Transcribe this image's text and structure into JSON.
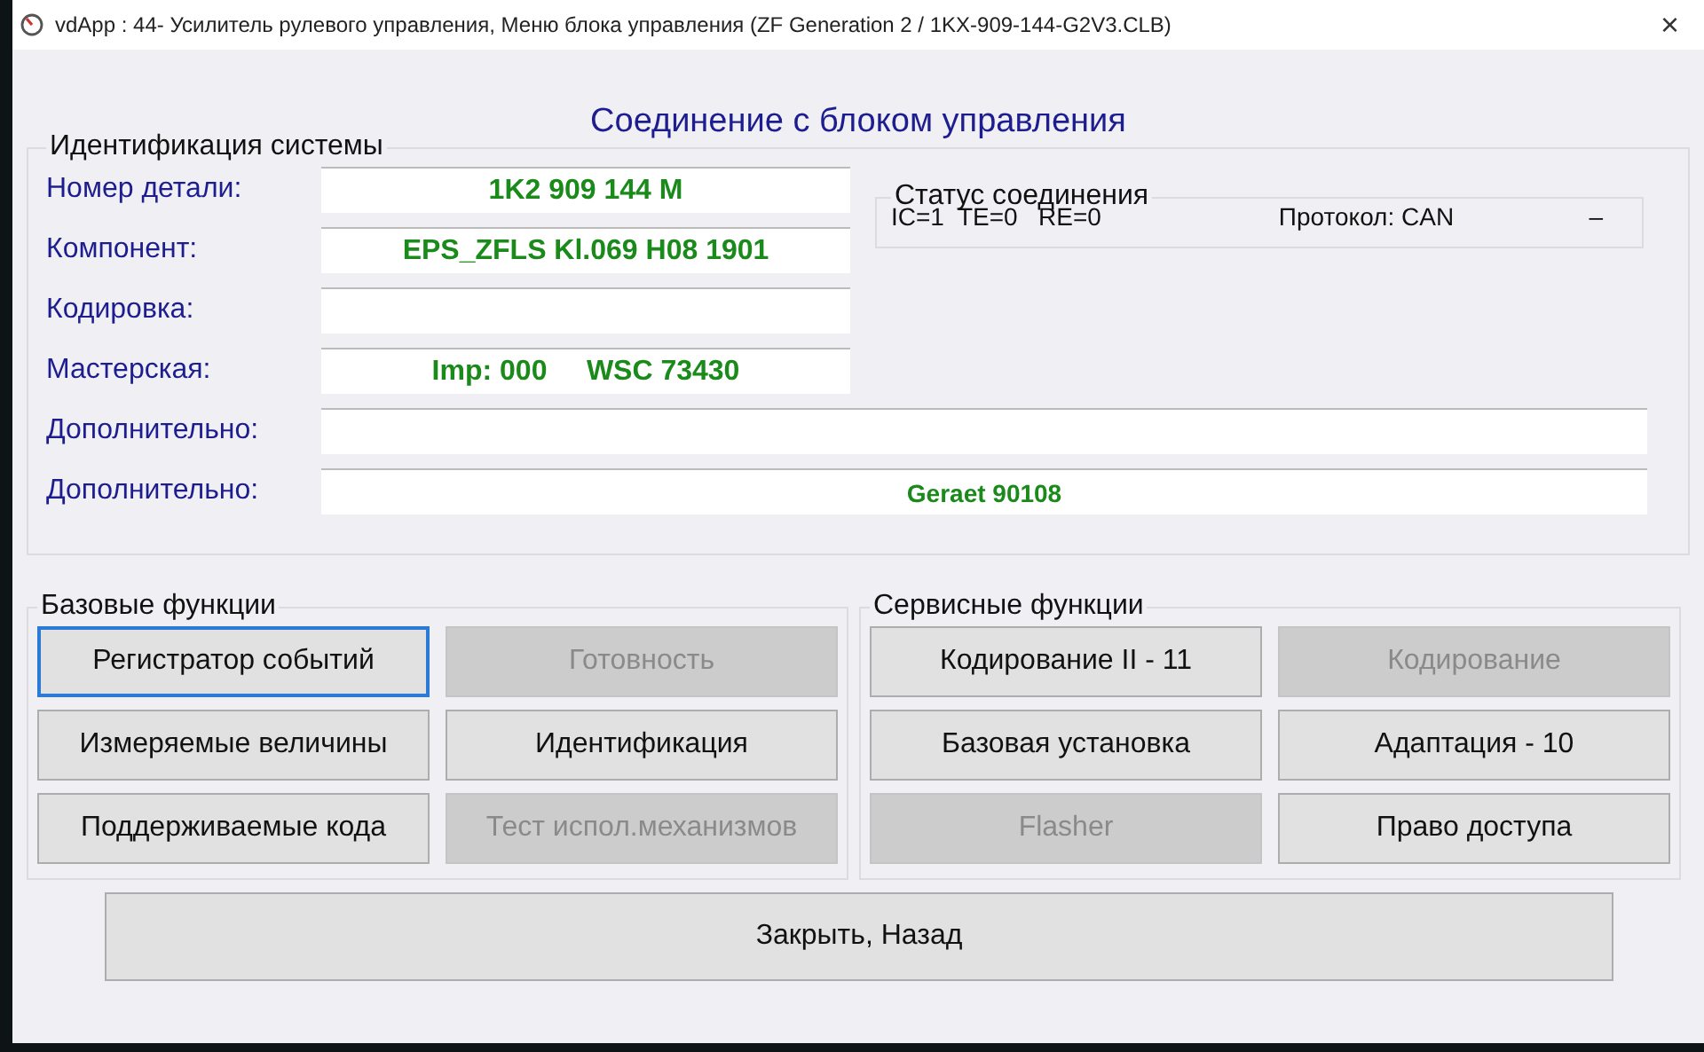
{
  "window": {
    "title": "vdApp : 44- Усилитель рулевого управления,  Меню блока управления (ZF Generation 2 / 1KX-909-144-G2V3.CLB)",
    "close": "×"
  },
  "heading": "Соединение с блоком управления",
  "identification": {
    "title": "Идентификация системы",
    "fields": [
      {
        "label": "Номер детали:",
        "value": "1K2 909 144 M"
      },
      {
        "label": "Компонент:",
        "value": "EPS_ZFLS Kl.069 H08 1901"
      },
      {
        "label": "Кодировка:"
      },
      {
        "label": "Мастерская:",
        "value": "Imp: 000     WSC 73430"
      }
    ],
    "extra_fields": [
      {
        "label": "Дополнительно:"
      },
      {
        "label": "Дополнительно:",
        "value": "Geraet 90108"
      }
    ]
  },
  "status": {
    "title": "Статус соединения",
    "counters": "IC=1  TE=0   RE=0",
    "protocol": "Протокол: CAN",
    "indicator": "–"
  },
  "basic": {
    "title": "Базовые функции",
    "buttons": [
      {
        "label": "Регистратор событий",
        "disabled": false,
        "focused": true
      },
      {
        "label": "Готовность",
        "disabled": true,
        "focused": false
      },
      {
        "label": "Измеряемые величины",
        "disabled": false,
        "focused": false
      },
      {
        "label": "Идентификация",
        "disabled": false,
        "focused": false
      },
      {
        "label": "Поддерживаемые кода",
        "disabled": false,
        "focused": false
      },
      {
        "label": "Тест испол.механизмов",
        "disabled": true,
        "focused": false
      }
    ]
  },
  "service": {
    "title": "Сервисные функции",
    "buttons": [
      {
        "label": "Кодирование II - 11",
        "disabled": false,
        "focused": false
      },
      {
        "label": "Кодирование",
        "disabled": true,
        "focused": false
      },
      {
        "label": "Базовая установка",
        "disabled": false,
        "focused": false
      },
      {
        "label": "Адаптация - 10",
        "disabled": false,
        "focused": false
      },
      {
        "label": "Flasher",
        "disabled": true,
        "focused": false
      },
      {
        "label": "Право доступа",
        "disabled": false,
        "focused": false
      }
    ]
  },
  "close_button": "Закрыть, Назад"
}
